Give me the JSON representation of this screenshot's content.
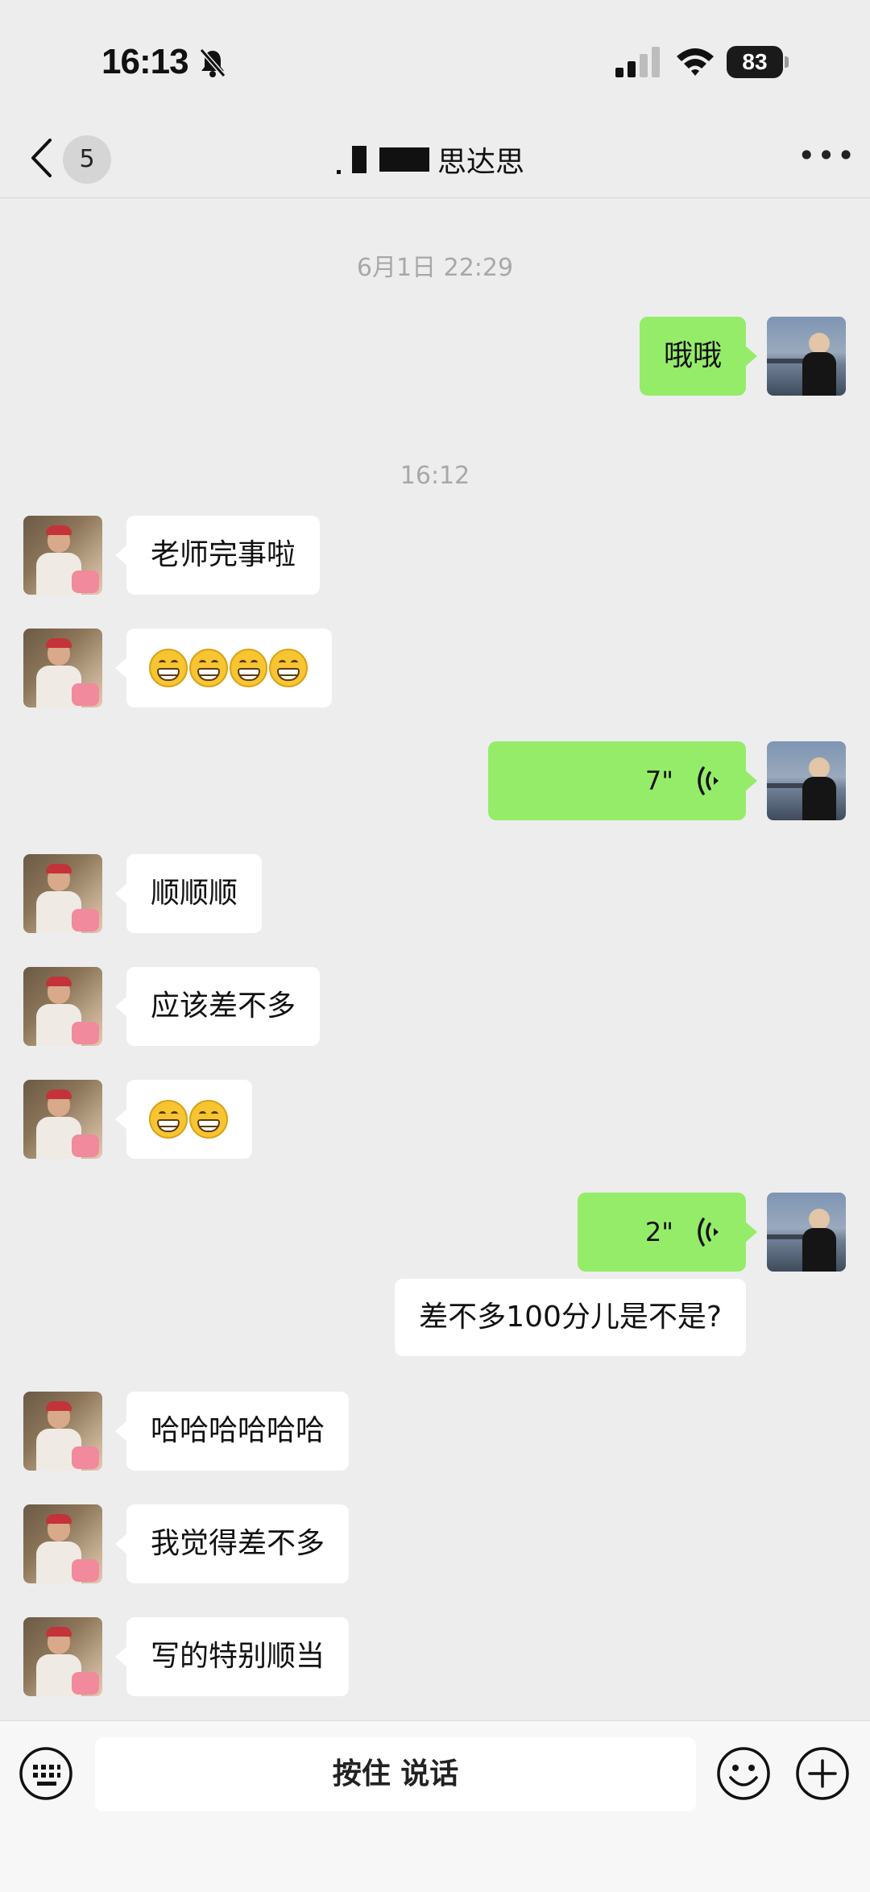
{
  "status_bar": {
    "time": "16:13",
    "battery": "83"
  },
  "nav": {
    "unread_count": "5",
    "title": "思达思"
  },
  "chat": {
    "timestamps": [
      "6月1日 22:29",
      "16:12"
    ],
    "messages": [
      {
        "from": "me",
        "type": "text",
        "text": "哦哦"
      },
      {
        "from": "other",
        "type": "text",
        "text": "老师完事啦"
      },
      {
        "from": "other",
        "type": "emoji",
        "emoji": "grin",
        "count": 4
      },
      {
        "from": "me",
        "type": "voice",
        "duration": "7\""
      },
      {
        "from": "other",
        "type": "text",
        "text": "顺顺顺"
      },
      {
        "from": "other",
        "type": "text",
        "text": "应该差不多"
      },
      {
        "from": "other",
        "type": "emoji",
        "emoji": "grin",
        "count": 2
      },
      {
        "from": "me",
        "type": "voice",
        "duration": "2\""
      },
      {
        "from": "me",
        "type": "voice-transcript",
        "text": "差不多100分儿是不是?"
      },
      {
        "from": "other",
        "type": "text",
        "text": "哈哈哈哈哈哈"
      },
      {
        "from": "other",
        "type": "text",
        "text": "我觉得差不多"
      },
      {
        "from": "other",
        "type": "text",
        "text": "写的特别顺当"
      }
    ]
  },
  "input_bar": {
    "hold_to_talk": "按住 说话"
  },
  "colors": {
    "background": "#ededed",
    "outgoing_bubble": "#95ec69",
    "incoming_bubble": "#ffffff"
  },
  "icons": [
    "bell-mute-icon",
    "signal-icon",
    "wifi-icon",
    "battery-icon",
    "back-chevron-icon",
    "more-icon",
    "voice-wave-icon",
    "keyboard-icon",
    "emoji-icon",
    "plus-icon",
    "grin-emoji-icon"
  ]
}
